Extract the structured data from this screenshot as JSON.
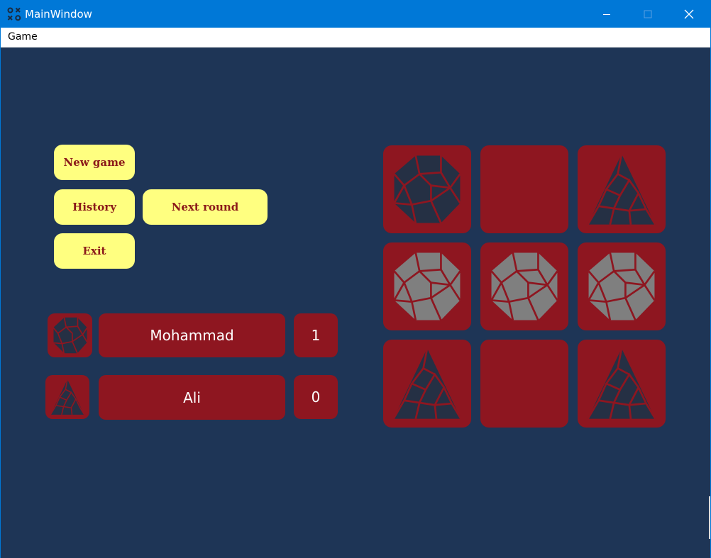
{
  "window": {
    "title": "MainWindow",
    "icon": "tic-tac-toe-icon"
  },
  "menu": {
    "items": [
      {
        "label": "Game"
      }
    ]
  },
  "controls": {
    "new_game": "New game",
    "history": "History",
    "next_round": "Next round",
    "exit": "Exit"
  },
  "players": [
    {
      "name": "Mohammad",
      "score": "1",
      "symbol": "dodecahedron-icon"
    },
    {
      "name": "Ali",
      "score": "0",
      "symbol": "triangle-icon"
    }
  ],
  "board": {
    "cells": [
      {
        "state": "dodecahedron",
        "highlight": false
      },
      {
        "state": "empty",
        "highlight": false
      },
      {
        "state": "triangle",
        "highlight": false
      },
      {
        "state": "dodecahedron",
        "highlight": true
      },
      {
        "state": "dodecahedron",
        "highlight": true
      },
      {
        "state": "dodecahedron",
        "highlight": true
      },
      {
        "state": "triangle",
        "highlight": false
      },
      {
        "state": "empty",
        "highlight": false
      },
      {
        "state": "triangle",
        "highlight": false
      }
    ]
  },
  "colors": {
    "background": "#1e3556",
    "accent_panel": "#8e1620",
    "button_bg": "#ffff80",
    "button_text": "#8b1a1a",
    "piece_dark": "#253044",
    "piece_highlight": "#7f7f7f"
  }
}
